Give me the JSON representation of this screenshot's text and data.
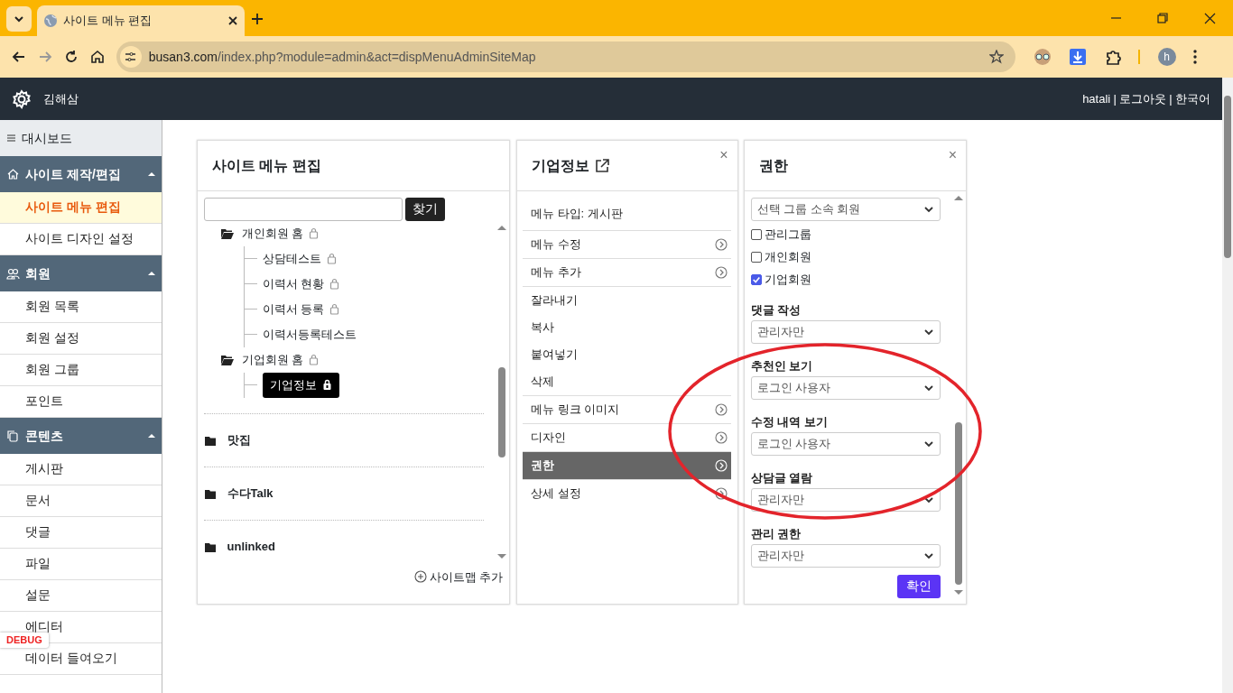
{
  "browser": {
    "tab_title": "사이트 메뉴 편집",
    "url_host": "busan3.com",
    "url_path": "/index.php?module=admin&act=dispMenuAdminSiteMap",
    "profile_initial": "h"
  },
  "header": {
    "site_name": "김해삼",
    "links": [
      "hatali",
      "로그아웃",
      "한국어"
    ],
    "separators": [
      "|",
      "|"
    ]
  },
  "sidebar": {
    "dashboard": "대시보드",
    "sections": [
      {
        "title": "사이트 제작/편집",
        "expanded": true,
        "items": [
          {
            "label": "사이트 메뉴 편집",
            "selected": true
          },
          {
            "label": "사이트 디자인 설정",
            "selected": false
          }
        ]
      },
      {
        "title": "회원",
        "expanded": true,
        "items": [
          {
            "label": "회원 목록",
            "selected": false
          },
          {
            "label": "회원 설정",
            "selected": false
          },
          {
            "label": "회원 그룹",
            "selected": false
          },
          {
            "label": "포인트",
            "selected": false
          }
        ]
      },
      {
        "title": "콘텐츠",
        "expanded": true,
        "items": [
          {
            "label": "게시판",
            "selected": false
          },
          {
            "label": "문서",
            "selected": false
          },
          {
            "label": "댓글",
            "selected": false
          },
          {
            "label": "파일",
            "selected": false
          },
          {
            "label": "설문",
            "selected": false
          },
          {
            "label": "에디터",
            "selected": false
          },
          {
            "label": "데이터 들여오기",
            "selected": false
          }
        ]
      }
    ]
  },
  "debug_badge": "DEBUG",
  "sitemap_panel": {
    "title": "사이트 메뉴 편집",
    "search_button": "찾기",
    "tree": [
      {
        "label": "개인회원 홈",
        "kind": "folder",
        "locked": true,
        "selected": false,
        "children": [
          {
            "label": "상담테스트",
            "kind": "page",
            "locked": true,
            "selected": false
          },
          {
            "label": "이력서 현황",
            "kind": "page",
            "locked": true,
            "selected": false
          },
          {
            "label": "이력서 등록",
            "kind": "page",
            "locked": true,
            "selected": false
          },
          {
            "label": "이력서등록테스트",
            "kind": "page",
            "locked": false,
            "selected": false
          }
        ]
      },
      {
        "label": "기업회원 홈",
        "kind": "folder",
        "locked": true,
        "selected": false,
        "children": [
          {
            "label": "기업정보",
            "kind": "page",
            "locked": true,
            "selected": true
          }
        ]
      }
    ],
    "sitemaps": [
      "맛집",
      "수다Talk",
      "unlinked"
    ],
    "add_sitemap": "사이트맵 추가"
  },
  "menu_panel": {
    "title": "기업정보",
    "close": "×",
    "groups": [
      [
        {
          "label": "메뉴 타입: 게시판",
          "kind": "info",
          "selected": false
        }
      ],
      [
        {
          "label": "메뉴 수정",
          "kind": "action",
          "selected": false
        }
      ],
      [
        {
          "label": "메뉴 추가",
          "kind": "action",
          "selected": false
        }
      ],
      [
        {
          "label": "잘라내기",
          "kind": "plain",
          "selected": false
        },
        {
          "label": "복사",
          "kind": "plain",
          "selected": false
        },
        {
          "label": "붙여넣기",
          "kind": "plain",
          "selected": false
        },
        {
          "label": "삭제",
          "kind": "plain",
          "selected": false
        }
      ],
      [
        {
          "label": "메뉴 링크 이미지",
          "kind": "action",
          "selected": false
        }
      ],
      [
        {
          "label": "디자인",
          "kind": "action",
          "selected": false
        }
      ],
      [
        {
          "label": "권한",
          "kind": "action",
          "selected": true
        }
      ],
      [
        {
          "label": "상세 설정",
          "kind": "action",
          "selected": false
        }
      ]
    ]
  },
  "permission_panel": {
    "title": "권한",
    "close": "×",
    "fields": [
      {
        "kind": "select",
        "value": "선택 그룹 소속 회원"
      },
      {
        "kind": "checkbox",
        "label": "관리그룹",
        "checked": false
      },
      {
        "kind": "checkbox",
        "label": "개인회원",
        "checked": false
      },
      {
        "kind": "checkbox",
        "label": "기업회원",
        "checked": true
      },
      {
        "kind": "select",
        "label": "댓글 작성",
        "value": "관리자만"
      },
      {
        "kind": "select",
        "label": "추천인 보기",
        "value": "로그인 사용자"
      },
      {
        "kind": "select",
        "label": "수정 내역 보기",
        "value": "로그인 사용자"
      },
      {
        "kind": "select",
        "label": "상담글 열람",
        "value": "관리자만"
      },
      {
        "kind": "select",
        "label": "관리 권한",
        "value": "관리자만"
      }
    ],
    "submit": "확인"
  },
  "annotation": {
    "kind": "ellipse",
    "color": "#e3242b"
  }
}
